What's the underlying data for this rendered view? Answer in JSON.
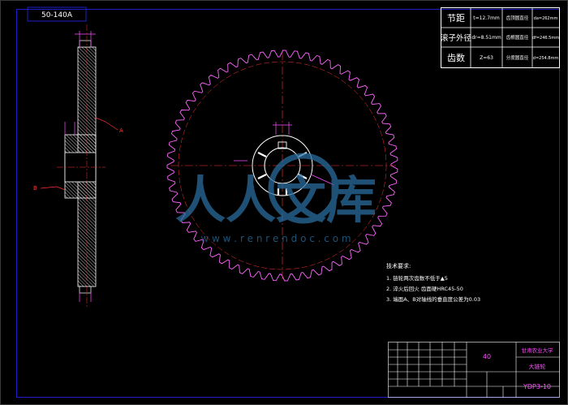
{
  "stamp": "50-140A",
  "param_table": {
    "rows": [
      {
        "label": "节距",
        "value": "t=12.7mm",
        "sub_label": "齿顶圆直径",
        "sub_value": "da=262mm"
      },
      {
        "label": "滚子外径",
        "value": "dr=8.51mm",
        "sub_label": "齿根圆直径",
        "sub_value": "df=246.5mm"
      },
      {
        "label": "齿数",
        "value": "Z=63",
        "sub_label": "分度圆直径",
        "sub_value": "d=254.8mm"
      }
    ]
  },
  "section_labels": {
    "a": "A",
    "b": "B"
  },
  "watermark": {
    "brand": "人人文库",
    "url": "w w w . r e n r e n d o c . c o m"
  },
  "tech_notes": {
    "title": "技术要求:",
    "items": [
      "1. 链轮两次齿数不低于▲5",
      "2. 淬火后回火   齿面硬HRC45-50",
      "3. 端面A、B对轴线的垂直度公差为0.03"
    ]
  },
  "title_block": {
    "material": "40",
    "school": "甘肃农业大学",
    "part_name": "大链轮",
    "drawing_no": "YDP3-10"
  },
  "colors": {
    "background": "#000000",
    "frame": "#1e1ec8",
    "teeth": "#ff66ff",
    "hatch": "#e6e6e6",
    "centerline": "#ff3333",
    "watermark": "#2a6d9e"
  }
}
